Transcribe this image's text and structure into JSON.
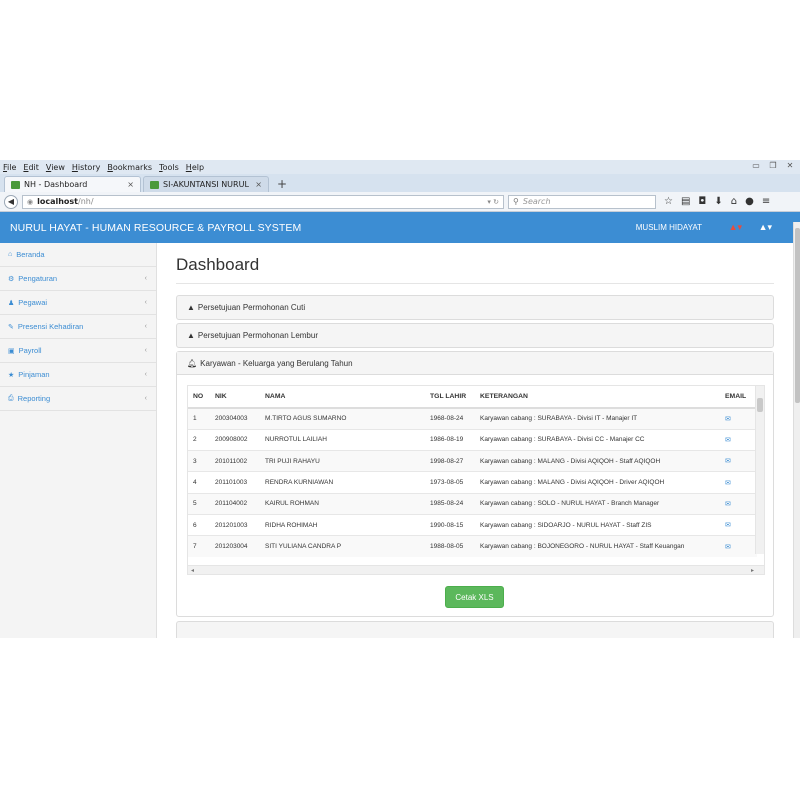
{
  "browser": {
    "menu": [
      "File",
      "Edit",
      "View",
      "History",
      "Bookmarks",
      "Tools",
      "Help"
    ],
    "tabs": [
      {
        "title": "NH - Dashboard",
        "close": "×"
      },
      {
        "title": "SI-AKUNTANSI NURUL HA...",
        "close": "×"
      }
    ],
    "new_tab": "+",
    "url_host": "localhost",
    "url_path": "/nh/",
    "search_placeholder": "Search"
  },
  "app": {
    "brand": "NURUL HAYAT - HUMAN RESOURCE & PAYROLL SYSTEM",
    "user": "MUSLIM HIDAYAT",
    "colors": {
      "header": "#3c8dd3",
      "sidebar_link": "#3c8dd3",
      "button_green": "#5cb85c"
    }
  },
  "sidebar": {
    "items": [
      {
        "label": "Beranda",
        "icon": "home-icon"
      },
      {
        "label": "Pengaturan",
        "icon": "cogs-icon"
      },
      {
        "label": "Pegawai",
        "icon": "users-icon"
      },
      {
        "label": "Presensi Kehadiran",
        "icon": "edit-icon"
      },
      {
        "label": "Payroll",
        "icon": "money-icon"
      },
      {
        "label": "Pinjaman",
        "icon": "star-icon"
      },
      {
        "label": "Reporting",
        "icon": "print-icon"
      }
    ]
  },
  "main": {
    "title": "Dashboard",
    "panels": [
      {
        "title": "Persetujuan Permohonan Cuti"
      },
      {
        "title": "Persetujuan Permohonan Lembur"
      },
      {
        "title": "Karyawan - Keluarga yang Berulang Tahun"
      }
    ],
    "table": {
      "headers": [
        "NO",
        "NIK",
        "NAMA",
        "TGL LAHIR",
        "KETERANGAN",
        "EMAIL"
      ],
      "rows": [
        [
          "1",
          "200304003",
          "M.TIRTO AGUS SUMARNO",
          "1968-08-24",
          "Karyawan cabang : SURABAYA - Divisi IT - Manajer IT"
        ],
        [
          "2",
          "200908002",
          "NURROTUL LAILIAH",
          "1986-08-19",
          "Karyawan cabang : SURABAYA - Divisi CC - Manajer CC"
        ],
        [
          "3",
          "201011002",
          "TRI PUJI RAHAYU",
          "1998-08-27",
          "Karyawan cabang : MALANG - Divisi AQIQOH - Staff AQIQOH"
        ],
        [
          "4",
          "201101003",
          "RENDRA KURNIAWAN",
          "1973-08-05",
          "Karyawan cabang : MALANG - Divisi AQIQOH - Driver AQIQOH"
        ],
        [
          "5",
          "201104002",
          "KAIRUL ROHMAN",
          "1985-08-24",
          "Karyawan cabang : SOLO - NURUL HAYAT - Branch Manager"
        ],
        [
          "6",
          "201201003",
          "RIDHA ROHIMAH",
          "1990-08-15",
          "Karyawan cabang : SIDOARJO - NURUL HAYAT - Staff ZIS"
        ],
        [
          "7",
          "201203004",
          "SITI YULIANA CANDRA P",
          "1988-08-05",
          "Karyawan cabang : BOJONEGORO - NURUL HAYAT - Staff Keuangan"
        ]
      ]
    },
    "export_button": "Cetak XLS"
  }
}
